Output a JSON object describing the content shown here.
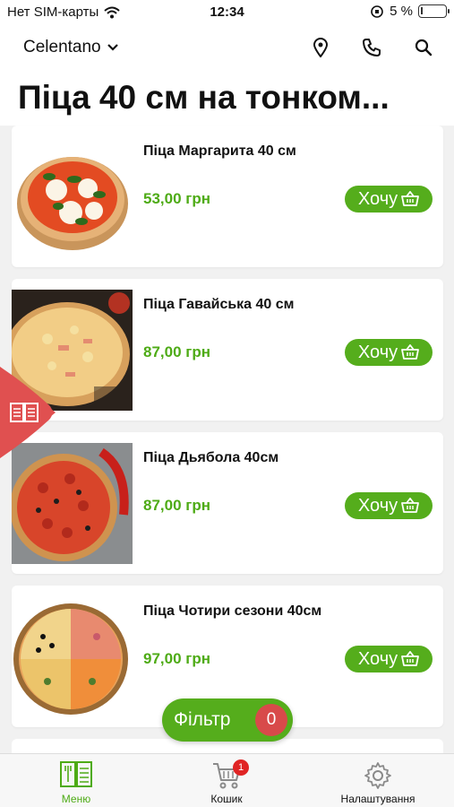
{
  "status_bar": {
    "carrier": "Нет SIM-карты",
    "time": "12:34",
    "battery": "5 %"
  },
  "header": {
    "brand": "Celentano",
    "icons": [
      "location-icon",
      "phone-icon",
      "search-icon"
    ]
  },
  "page_title": "Піца 40 см на тонком...",
  "products": [
    {
      "name": "Піца Маргарита 40 см",
      "price": "53,00 грн",
      "button": "Хочу"
    },
    {
      "name": "Піца Гавайська 40 см",
      "price": "87,00 грн",
      "button": "Хочу"
    },
    {
      "name": "Піца Дьябола 40см",
      "price": "87,00 грн",
      "button": "Хочу"
    },
    {
      "name": "Піца Чотири сезони 40см",
      "price": "97,00 грн",
      "button": "Хочу"
    }
  ],
  "filter": {
    "label": "Фільтр",
    "count": "0"
  },
  "tabbar": {
    "menu": "Меню",
    "cart": "Кошик",
    "cart_badge": "1",
    "settings": "Налаштування"
  },
  "colors": {
    "accent_green": "#55ad1c",
    "price_green": "#4eab16",
    "side_tab_red": "#e05050",
    "badge_red": "#e02525"
  }
}
